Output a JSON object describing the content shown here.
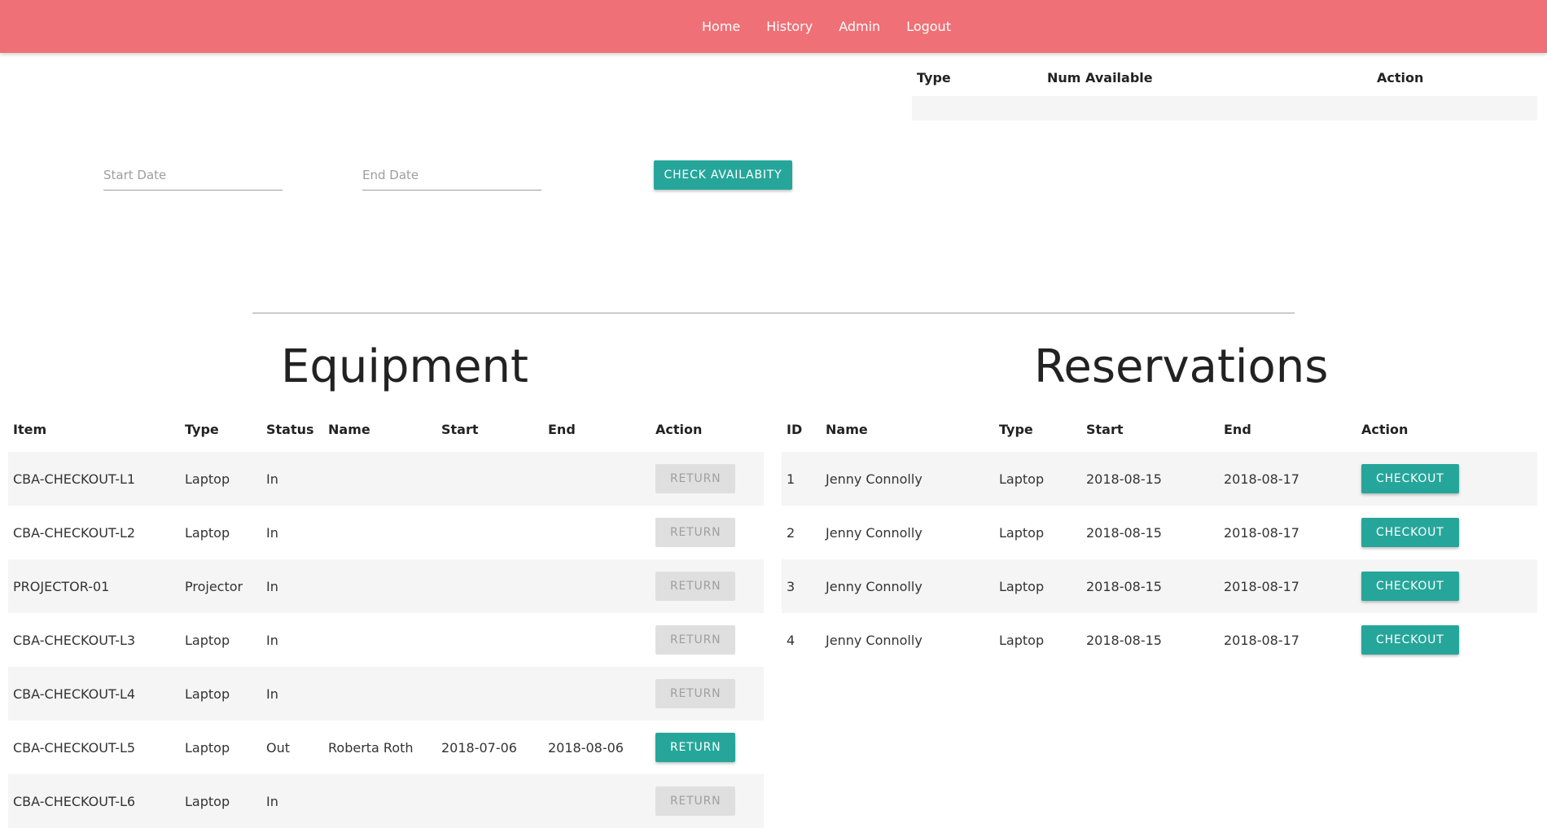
{
  "nav": {
    "links": [
      "Home",
      "History",
      "Admin",
      "Logout"
    ]
  },
  "availability": {
    "headers": [
      "Type",
      "Num Available",
      "Action"
    ],
    "rows": []
  },
  "date_form": {
    "start_placeholder": "Start Date",
    "end_placeholder": "End Date",
    "check_button": "Check Availabity"
  },
  "equipment": {
    "title": "Equipment",
    "headers": [
      "Item",
      "Type",
      "Status",
      "Name",
      "Start",
      "End",
      "Action"
    ],
    "rows": [
      {
        "item": "CBA-CHECKOUT-L1",
        "type": "Laptop",
        "status": "In",
        "name": "",
        "start": "",
        "end": "",
        "action": "Return",
        "enabled": false
      },
      {
        "item": "CBA-CHECKOUT-L2",
        "type": "Laptop",
        "status": "In",
        "name": "",
        "start": "",
        "end": "",
        "action": "Return",
        "enabled": false
      },
      {
        "item": "PROJECTOR-01",
        "type": "Projector",
        "status": "In",
        "name": "",
        "start": "",
        "end": "",
        "action": "Return",
        "enabled": false
      },
      {
        "item": "CBA-CHECKOUT-L3",
        "type": "Laptop",
        "status": "In",
        "name": "",
        "start": "",
        "end": "",
        "action": "Return",
        "enabled": false
      },
      {
        "item": "CBA-CHECKOUT-L4",
        "type": "Laptop",
        "status": "In",
        "name": "",
        "start": "",
        "end": "",
        "action": "Return",
        "enabled": false
      },
      {
        "item": "CBA-CHECKOUT-L5",
        "type": "Laptop",
        "status": "Out",
        "name": "Roberta Roth",
        "start": "2018-07-06",
        "end": "2018-08-06",
        "action": "Return",
        "enabled": true
      },
      {
        "item": "CBA-CHECKOUT-L6",
        "type": "Laptop",
        "status": "In",
        "name": "",
        "start": "",
        "end": "",
        "action": "Return",
        "enabled": false
      }
    ]
  },
  "reservations": {
    "title": "Reservations",
    "headers": [
      "ID",
      "Name",
      "Type",
      "Start",
      "End",
      "Action"
    ],
    "rows": [
      {
        "id": "1",
        "name": "Jenny Connolly",
        "type": "Laptop",
        "start": "2018-08-15",
        "end": "2018-08-17",
        "action": "Checkout"
      },
      {
        "id": "2",
        "name": "Jenny Connolly",
        "type": "Laptop",
        "start": "2018-08-15",
        "end": "2018-08-17",
        "action": "Checkout"
      },
      {
        "id": "3",
        "name": "Jenny Connolly",
        "type": "Laptop",
        "start": "2018-08-15",
        "end": "2018-08-17",
        "action": "Checkout"
      },
      {
        "id": "4",
        "name": "Jenny Connolly",
        "type": "Laptop",
        "start": "2018-08-15",
        "end": "2018-08-17",
        "action": "Checkout"
      }
    ]
  },
  "colors": {
    "navbar": "#ef7076",
    "accent": "#26a69a",
    "disabled_button": "#dfdfdf",
    "stripe": "#f5f5f5"
  }
}
